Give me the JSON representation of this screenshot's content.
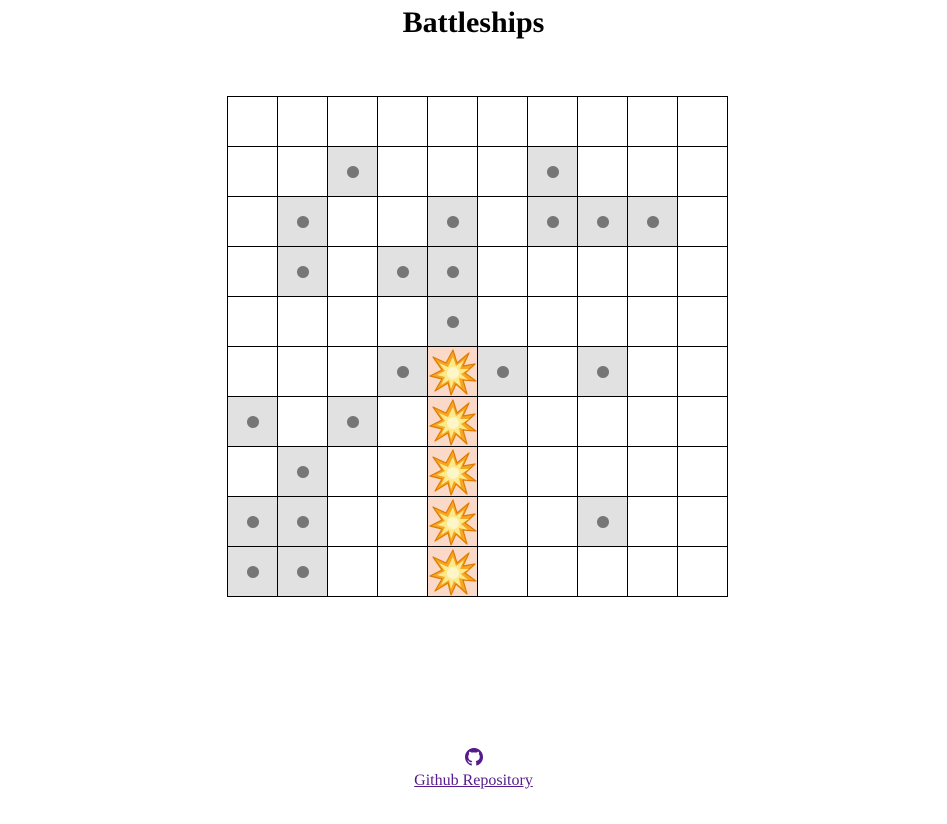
{
  "page": {
    "title": "Battleships"
  },
  "board": {
    "rows": 10,
    "cols": 10,
    "cells": [
      [
        "empty",
        "empty",
        "empty",
        "empty",
        "empty",
        "empty",
        "empty",
        "empty",
        "empty",
        "empty"
      ],
      [
        "empty",
        "empty",
        "miss",
        "empty",
        "empty",
        "empty",
        "miss",
        "empty",
        "empty",
        "empty"
      ],
      [
        "empty",
        "miss",
        "empty",
        "empty",
        "miss",
        "empty",
        "miss",
        "miss",
        "miss",
        "empty"
      ],
      [
        "empty",
        "miss",
        "empty",
        "miss",
        "miss",
        "empty",
        "empty",
        "empty",
        "empty",
        "empty"
      ],
      [
        "empty",
        "empty",
        "empty",
        "empty",
        "miss",
        "empty",
        "empty",
        "empty",
        "empty",
        "empty"
      ],
      [
        "empty",
        "empty",
        "empty",
        "miss",
        "hit",
        "miss",
        "empty",
        "miss",
        "empty",
        "empty"
      ],
      [
        "miss",
        "empty",
        "miss",
        "empty",
        "hit",
        "empty",
        "empty",
        "empty",
        "empty",
        "empty"
      ],
      [
        "empty",
        "miss",
        "empty",
        "empty",
        "hit",
        "empty",
        "empty",
        "empty",
        "empty",
        "empty"
      ],
      [
        "miss",
        "miss",
        "empty",
        "empty",
        "hit",
        "empty",
        "empty",
        "miss",
        "empty",
        "empty"
      ],
      [
        "miss",
        "miss",
        "empty",
        "empty",
        "hit",
        "empty",
        "empty",
        "empty",
        "empty",
        "empty"
      ]
    ],
    "colors": {
      "empty": "#ffffff",
      "miss": "#e1e1e1",
      "hit": "#fbd9c9",
      "miss_marker": "#767676",
      "grid_line": "#000000"
    },
    "icons": {
      "miss": "miss-dot-icon",
      "hit": "explosion-icon"
    }
  },
  "footer": {
    "icon": "github-icon",
    "link_label": "Github Repository",
    "link_color": "#551a8b"
  }
}
